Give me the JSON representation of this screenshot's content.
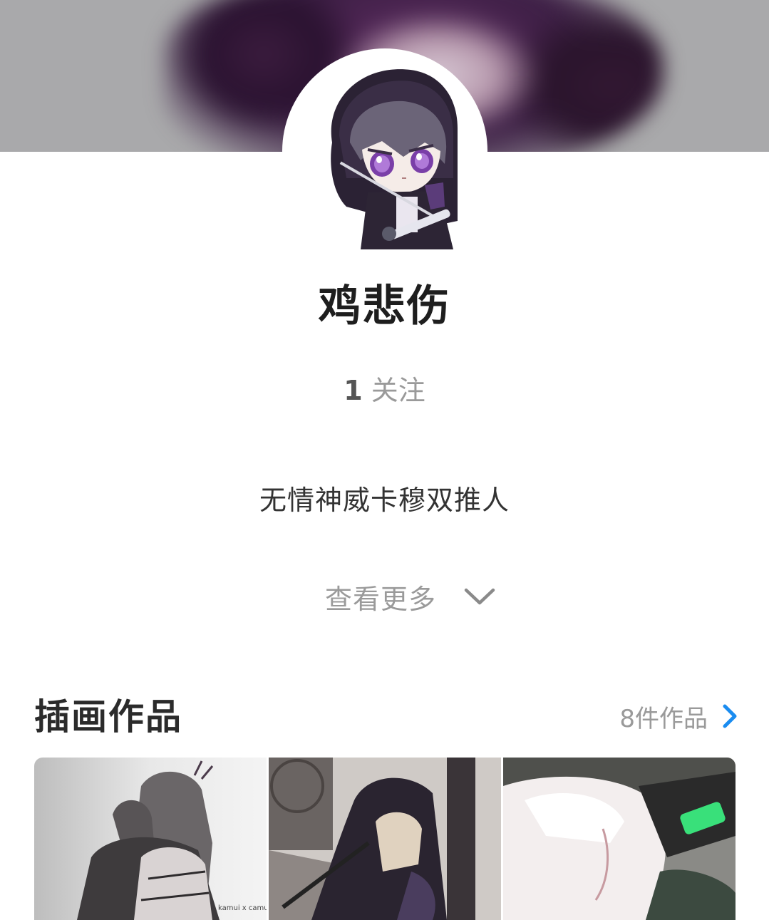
{
  "profile": {
    "name": "鸡悲伤",
    "follow_count": "1",
    "follow_label": "关注",
    "bio": "无情神威卡穆双推人",
    "show_more_label": "查看更多"
  },
  "icons": {
    "show_more": "chevron-down-icon",
    "section_link": "chevron-right-icon"
  },
  "colors": {
    "accent": "#1a8cf0",
    "muted_text": "#9a9a9a",
    "primary_text": "#1e1e1e"
  },
  "illustrations": {
    "title": "插画作品",
    "count_label": "8件作品",
    "items": [
      {
        "label": "artwork-1",
        "signature": "kamui x camu"
      },
      {
        "label": "artwork-2"
      },
      {
        "label": "artwork-3"
      }
    ]
  }
}
